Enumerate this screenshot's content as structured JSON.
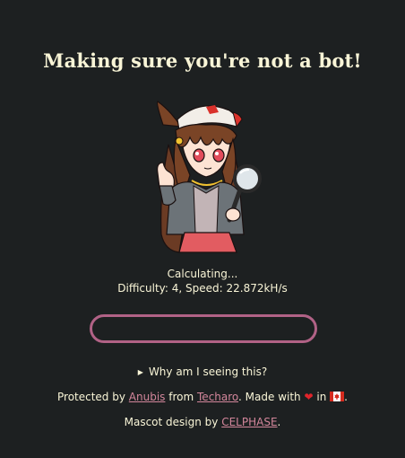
{
  "page": {
    "title": "Making sure you're not a bot!"
  },
  "status": {
    "message": "Calculating...",
    "details": "Difficulty: 4, Speed: 22.872kH/s"
  },
  "progress": {
    "value": 0,
    "accent_color": "#b16286"
  },
  "why": {
    "label": "Why am I seeing this?",
    "icon": "disclosure-triangle-icon"
  },
  "footer": {
    "protected_by": "Protected by",
    "anubis_link": "Anubis",
    "from": "from",
    "techaro_link": "Techaro",
    "made_with": ". Made with",
    "in": "in",
    "end": ".",
    "heart_icon": "heart-icon",
    "flag_icon": "canada-flag-icon",
    "mascot_by": "Mascot design by",
    "celphase_link": "CELPHASE",
    "mascot_end": "."
  },
  "colors": {
    "background": "#1d2021",
    "text": "#f9f5d7",
    "link": "#d3869b",
    "heart": "#e0242b"
  },
  "mascot": {
    "icon": "anubis-mascot-image"
  }
}
